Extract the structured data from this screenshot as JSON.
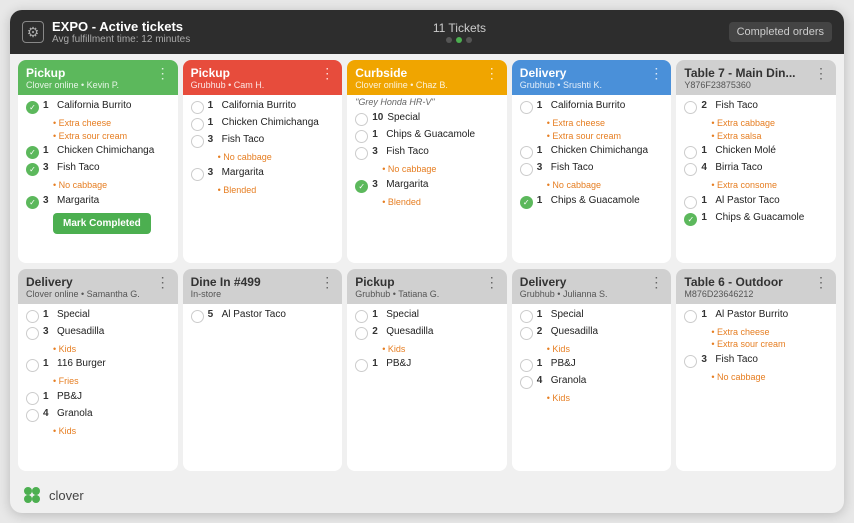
{
  "header": {
    "title": "EXPO - Active tickets",
    "subtitle": "Avg fulfillment time: 12 minutes",
    "tickets_count": "11 Tickets",
    "completed_orders_label": "Completed orders",
    "dots": [
      0,
      1,
      2,
      3,
      4
    ]
  },
  "row1": [
    {
      "id": "pickup-kevin",
      "header_color": "green",
      "title": "Pickup",
      "subtitle": "Clover online • Kevin P.",
      "note": null,
      "items": [
        {
          "checked": true,
          "qty": "1",
          "name": "California Burrito",
          "mods": [
            "Extra cheese",
            "Extra sour cream"
          ]
        },
        {
          "checked": true,
          "qty": "1",
          "name": "Chicken Chimichanga",
          "mods": []
        },
        {
          "checked": true,
          "qty": "3",
          "name": "Fish Taco",
          "mods": [
            "No cabbage"
          ]
        },
        {
          "checked": true,
          "qty": "3",
          "name": "Margarita",
          "mods": [],
          "show_btn": true
        }
      ]
    },
    {
      "id": "pickup-cam",
      "header_color": "red",
      "title": "Pickup",
      "subtitle": "Grubhub • Cam H.",
      "note": null,
      "items": [
        {
          "checked": false,
          "qty": "1",
          "name": "California Burrito",
          "mods": []
        },
        {
          "checked": false,
          "qty": "1",
          "name": "Chicken Chimichanga",
          "mods": []
        },
        {
          "checked": false,
          "qty": "3",
          "name": "Fish Taco",
          "mods": [
            "No cabbage"
          ]
        },
        {
          "checked": false,
          "qty": "3",
          "name": "Margarita",
          "mods": [
            "Blended"
          ]
        }
      ]
    },
    {
      "id": "curbside-chaz",
      "header_color": "orange",
      "title": "Curbside",
      "subtitle": "Clover online • Chaz B.",
      "note": "\"Grey Honda HR-V\"",
      "items": [
        {
          "checked": false,
          "qty": "10",
          "name": "Special",
          "mods": []
        },
        {
          "checked": false,
          "qty": "1",
          "name": "Chips & Guacamole",
          "mods": []
        },
        {
          "checked": false,
          "qty": "3",
          "name": "Fish Taco",
          "mods": [
            "No cabbage"
          ]
        },
        {
          "checked": true,
          "qty": "3",
          "name": "Margarita",
          "mods": [
            "Blended"
          ]
        }
      ]
    },
    {
      "id": "delivery-srushti",
      "header_color": "blue",
      "title": "Delivery",
      "subtitle": "Grubhub • Srushti K.",
      "note": null,
      "items": [
        {
          "checked": false,
          "qty": "1",
          "name": "California Burrito",
          "mods": [
            "Extra cheese",
            "Extra sour cream"
          ]
        },
        {
          "checked": false,
          "qty": "1",
          "name": "Chicken Chimichanga",
          "mods": []
        },
        {
          "checked": false,
          "qty": "3",
          "name": "Fish Taco",
          "mods": [
            "No cabbage"
          ]
        },
        {
          "checked": true,
          "qty": "1",
          "name": "Chips & Guacamole",
          "mods": []
        }
      ]
    },
    {
      "id": "table7-main",
      "header_color": "gray",
      "title": "Table 7 - Main Din...",
      "subtitle": "Y876F23875360",
      "note": null,
      "items": [
        {
          "checked": false,
          "qty": "2",
          "name": "Fish Taco",
          "mods": [
            "Extra cabbage",
            "Extra salsa"
          ]
        },
        {
          "checked": false,
          "qty": "1",
          "name": "Chicken Molé",
          "mods": []
        },
        {
          "checked": false,
          "qty": "4",
          "name": "Birria Taco",
          "mods": [
            "Extra consome"
          ]
        },
        {
          "checked": false,
          "qty": "1",
          "name": "Al Pastor Taco",
          "mods": []
        },
        {
          "checked": true,
          "qty": "1",
          "name": "Chips & Guacamole",
          "mods": []
        }
      ]
    }
  ],
  "row2": [
    {
      "id": "delivery-samantha",
      "header_color": "gray",
      "title": "Delivery",
      "subtitle": "Clover online • Samantha G.",
      "note": null,
      "items": [
        {
          "checked": false,
          "qty": "1",
          "name": "Special",
          "mods": []
        },
        {
          "checked": false,
          "qty": "3",
          "name": "Quesadilla",
          "mods": [
            "Kids"
          ]
        },
        {
          "checked": false,
          "qty": "1",
          "name": "116 Burger",
          "mods": [
            "Fries"
          ]
        },
        {
          "checked": false,
          "qty": "1",
          "name": "PB&J",
          "mods": []
        },
        {
          "checked": false,
          "qty": "4",
          "name": "Granola",
          "mods": [
            "Kids"
          ]
        }
      ]
    },
    {
      "id": "dinein-499",
      "header_color": "gray",
      "title": "Dine In #499",
      "subtitle": "In-store",
      "note": null,
      "items": [
        {
          "checked": false,
          "qty": "5",
          "name": "Al Pastor Taco",
          "mods": []
        }
      ]
    },
    {
      "id": "pickup-tatiana",
      "header_color": "gray",
      "title": "Pickup",
      "subtitle": "Grubhub • Tatiana G.",
      "note": null,
      "items": [
        {
          "checked": false,
          "qty": "1",
          "name": "Special",
          "mods": []
        },
        {
          "checked": false,
          "qty": "2",
          "name": "Quesadilla",
          "mods": [
            "Kids"
          ]
        },
        {
          "checked": false,
          "qty": "1",
          "name": "PB&J",
          "mods": []
        }
      ]
    },
    {
      "id": "delivery-julianna",
      "header_color": "gray",
      "title": "Delivery",
      "subtitle": "Grubhub • Julianna S.",
      "note": null,
      "items": [
        {
          "checked": false,
          "qty": "1",
          "name": "Special",
          "mods": []
        },
        {
          "checked": false,
          "qty": "2",
          "name": "Quesadilla",
          "mods": [
            "Kids"
          ]
        },
        {
          "checked": false,
          "qty": "1",
          "name": "PB&J",
          "mods": []
        },
        {
          "checked": false,
          "qty": "4",
          "name": "Granola",
          "mods": [
            "Kids"
          ]
        }
      ]
    },
    {
      "id": "table6-outdoor",
      "header_color": "gray",
      "title": "Table 6 - Outdoor",
      "subtitle": "M876D23646212",
      "note": null,
      "items": [
        {
          "checked": false,
          "qty": "1",
          "name": "Al Pastor Burrito",
          "mods": [
            "Extra cheese",
            "Extra sour cream"
          ]
        },
        {
          "checked": false,
          "qty": "3",
          "name": "Fish Taco",
          "mods": [
            "No cabbage"
          ]
        }
      ]
    }
  ],
  "footer": {
    "logo_text": "clover"
  },
  "mark_completed_label": "Mark Completed"
}
